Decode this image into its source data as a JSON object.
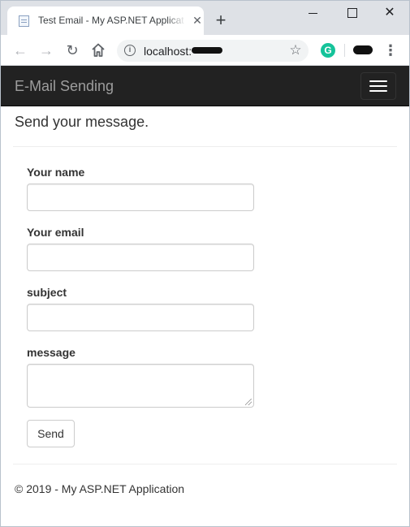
{
  "browser": {
    "tab": {
      "title": "Test Email - My ASP.NET Application",
      "close_glyph": "✕"
    },
    "new_tab_glyph": "+",
    "window_controls": {
      "close_glyph": "✕"
    },
    "toolbar": {
      "back_glyph": "←",
      "forward_glyph": "→",
      "reload_glyph": "↻",
      "info_glyph": "i",
      "address": "localhost:",
      "star_glyph": "☆",
      "grammarly_glyph": "G",
      "menu_glyph": "⋮"
    },
    "icons": [
      "page-favicon-icon",
      "back-arrow-icon",
      "forward-arrow-icon",
      "reload-icon",
      "home-icon",
      "info-icon",
      "star-icon",
      "grammarly-icon",
      "menu-dots-icon",
      "minimize-icon",
      "maximize-icon",
      "close-icon"
    ]
  },
  "navbar": {
    "brand": "E-Mail Sending",
    "background": "#222222",
    "brand_color": "#9d9d9d"
  },
  "page": {
    "heading": "Send your message.",
    "form": {
      "name_label": "Your name",
      "email_label": "Your email",
      "subject_label": "subject",
      "message_label": "message",
      "name_value": "",
      "email_value": "",
      "subject_value": "",
      "message_value": "",
      "send_label": "Send"
    },
    "footer": "© 2019 - My ASP.NET Application"
  }
}
